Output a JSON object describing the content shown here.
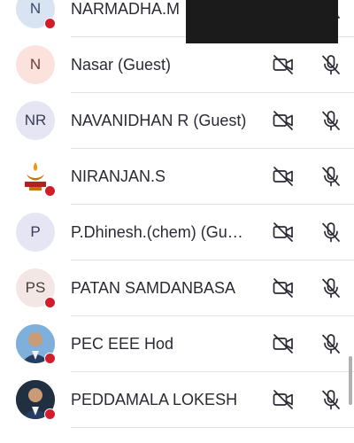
{
  "participants": [
    {
      "initials": "N",
      "name": "NARMADHA.M",
      "avatar_bg": "#d8e4f2",
      "avatar_color": "#3b4b6b",
      "presence": true
    },
    {
      "initials": "N",
      "name": "Nasar (Guest)",
      "avatar_bg": "#fbe2dd",
      "avatar_color": "#6b3b35",
      "presence": false
    },
    {
      "initials": "NR",
      "name": "NAVANIDHAN R (Guest)",
      "avatar_bg": "#e6e5f3",
      "avatar_color": "#3b3b5a",
      "presence": false
    },
    {
      "initials": "",
      "name": "NIRANJAN.S",
      "avatar_bg": "#ffffff",
      "avatar_color": "#000000",
      "presence": true,
      "avatar_icon": "lamp-logo-icon"
    },
    {
      "initials": "P",
      "name": "P.Dhinesh.(chem) (Guest)",
      "avatar_bg": "#e6e5f3",
      "avatar_color": "#3b3b5a",
      "presence": false
    },
    {
      "initials": "PS",
      "name": "PATAN SAMDANBASA",
      "avatar_bg": "#f2e7e4",
      "avatar_color": "#4a3b35",
      "presence": true
    },
    {
      "initials": "",
      "name": "PEC EEE Hod",
      "avatar_bg": "#7fb0dc",
      "avatar_color": "#000000",
      "presence": true,
      "avatar_icon": "person-photo-icon"
    },
    {
      "initials": "",
      "name": "PEDDAMALA LOKESH",
      "avatar_bg": "#203040",
      "avatar_color": "#000000",
      "presence": true,
      "avatar_icon": "person-photo-icon"
    }
  ],
  "icons": {
    "camera": "camera-off-icon",
    "mic": "mic-off-icon"
  },
  "colors": {
    "presence_busy": "#d21e2b",
    "text": "#2a2a35",
    "divider": "#e2e2e2"
  }
}
